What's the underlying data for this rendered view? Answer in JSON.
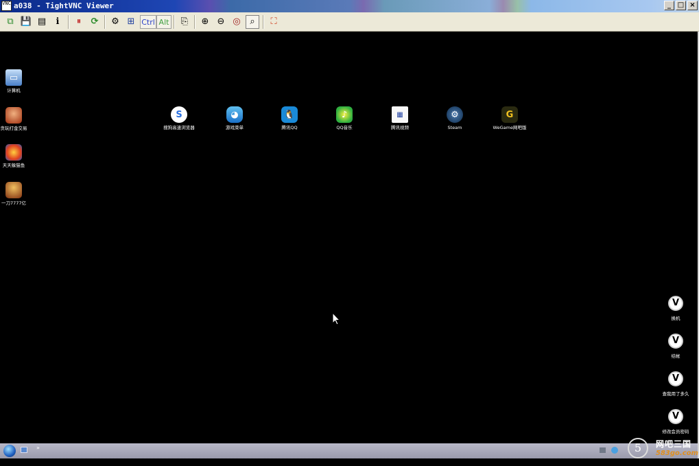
{
  "window": {
    "title": "a038 - TightVNC Viewer",
    "app_icon_text": "VNC",
    "controls": {
      "minimize": "_",
      "maximize": "□",
      "close": "×"
    }
  },
  "toolbar": {
    "items": [
      {
        "name": "new-connection-icon",
        "glyph": "⧉"
      },
      {
        "name": "save-icon",
        "glyph": "💾"
      },
      {
        "name": "options-icon",
        "glyph": "▤"
      },
      {
        "name": "connection-info-icon",
        "glyph": "ℹ"
      },
      {
        "name": "pause-icon",
        "glyph": "⏸"
      },
      {
        "name": "refresh-icon",
        "glyph": "⟳"
      },
      {
        "name": "ctrl-alt-del-icon",
        "glyph": "⚙"
      },
      {
        "name": "win-key-icon",
        "glyph": "⊞"
      },
      {
        "name": "transfer-icon",
        "glyph": "⎘"
      },
      {
        "name": "zoom-in-icon",
        "glyph": "⊕"
      },
      {
        "name": "zoom-out-icon",
        "glyph": "⊖"
      },
      {
        "name": "zoom-100-icon",
        "glyph": "◎"
      },
      {
        "name": "zoom-auto-icon",
        "glyph": "⌕"
      },
      {
        "name": "fullscreen-icon",
        "glyph": "⛶"
      }
    ],
    "ctrl_label": "Ctrl",
    "alt_label": "Alt"
  },
  "desktop": {
    "left_icons": [
      {
        "label": "计算机",
        "icon": "computer-icon"
      },
      {
        "label": "贪玩打金交易",
        "icon": "game-icon"
      },
      {
        "label": "天天躲猫鱼",
        "icon": "fish-game-icon"
      },
      {
        "label": "一刀7777亿",
        "icon": "sword-game-icon"
      }
    ],
    "row_icons": [
      {
        "label": "搜狗高速浏览器",
        "icon": "sogou-browser-icon",
        "glyph": "S"
      },
      {
        "label": "游戏菜单",
        "icon": "game-menu-icon",
        "glyph": "◕"
      },
      {
        "label": "腾讯QQ",
        "icon": "qq-icon",
        "glyph": "🐧"
      },
      {
        "label": "QQ音乐",
        "icon": "qq-music-icon",
        "glyph": "♪"
      },
      {
        "label": "腾讯视频",
        "icon": "tencent-video-icon",
        "glyph": "▦"
      },
      {
        "label": "Steam",
        "icon": "steam-icon",
        "glyph": "⚙"
      },
      {
        "label": "WeGame网吧版",
        "icon": "wegame-icon",
        "glyph": "G"
      }
    ],
    "right_icons": [
      {
        "label": "换机",
        "glyph": "V"
      },
      {
        "label": "结帐",
        "glyph": "V"
      },
      {
        "label": "查我用了多久",
        "glyph": "V"
      },
      {
        "label": "修改会员密码",
        "glyph": "V"
      }
    ]
  },
  "taskbar": {
    "quicklaunch_glyph": "»"
  },
  "watermark": {
    "number": "5",
    "text_cn": "网吧三国",
    "text_en": "583go.com"
  }
}
